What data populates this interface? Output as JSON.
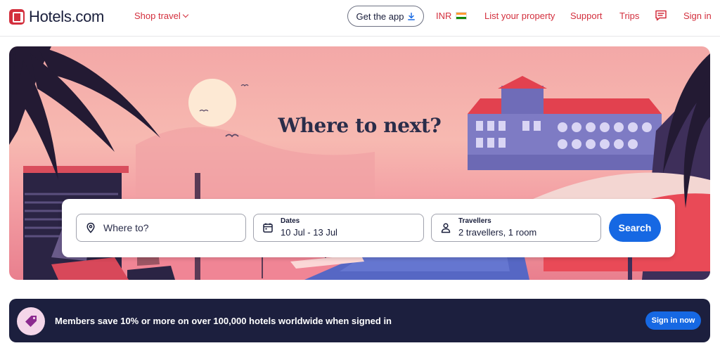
{
  "header": {
    "logo_text": "Hotels.com",
    "shop_travel": "Shop travel",
    "get_app": "Get the app",
    "currency": "INR",
    "list_property": "List your property",
    "support": "Support",
    "trips": "Trips",
    "sign_in": "Sign in",
    "icons": [
      "hotels-logo-icon",
      "chevron-down-icon",
      "download-icon",
      "india-flag-icon",
      "chat-icon"
    ]
  },
  "hero": {
    "title": "Where to next?",
    "search": {
      "destination_placeholder": "Where to?",
      "dates_label": "Dates",
      "dates_value": "10 Jul - 13 Jul",
      "travellers_label": "Travellers",
      "travellers_value": "2 travellers, 1 room",
      "search_button": "Search",
      "icons": [
        "location-pin-icon",
        "calendar-icon",
        "person-icon"
      ]
    }
  },
  "members_banner": {
    "text": "Members save 10% or more on over 100,000 hotels worldwide when signed in",
    "button": "Sign in now",
    "icon": "price-tag-icon"
  },
  "colors": {
    "brand_red": "#d32f3d",
    "primary_blue": "#1668e3",
    "banner_navy": "#1c1f3e",
    "text_dark": "#191e3b"
  }
}
